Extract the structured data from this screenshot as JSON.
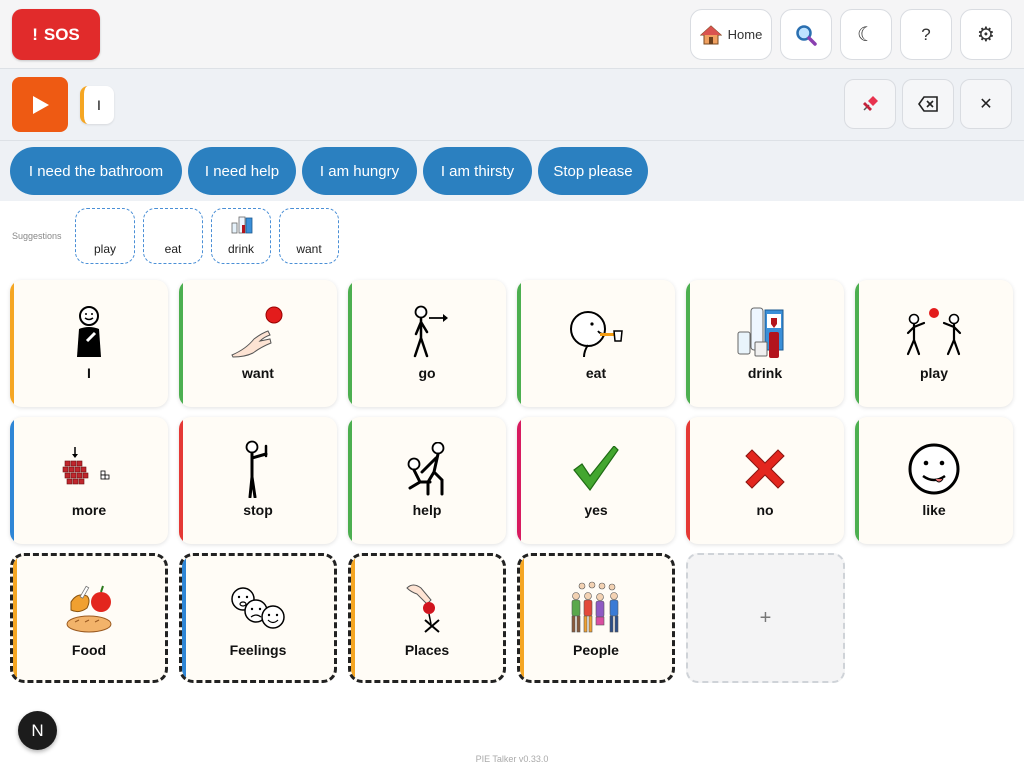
{
  "colors": {
    "sos": "#e12b2b",
    "play": "#ee5a13",
    "phrase": "#2b80c0",
    "orange": "#f5a623",
    "green": "#4caf50",
    "blue": "#2f86d6",
    "red": "#e53935",
    "pink": "#d81b60"
  },
  "header": {
    "sos_icon": "!",
    "sos_label": "SOS",
    "home_label": "Home",
    "moon_glyph": "☾",
    "help_glyph": "?",
    "gear_glyph": "⚙"
  },
  "message": {
    "words": [
      "I"
    ],
    "clear_glyph": "✕"
  },
  "phrases": [
    "I need the bathroom",
    "I need help",
    "I am hungry",
    "I am thirsty",
    "Stop please"
  ],
  "suggestions": {
    "label": "Suggestions",
    "items": [
      "play",
      "eat",
      "drink",
      "want"
    ]
  },
  "tiles": [
    {
      "label": "I",
      "color": "orange"
    },
    {
      "label": "want",
      "color": "green"
    },
    {
      "label": "go",
      "color": "green"
    },
    {
      "label": "eat",
      "color": "green"
    },
    {
      "label": "drink",
      "color": "green"
    },
    {
      "label": "play",
      "color": "green"
    },
    {
      "label": "more",
      "color": "blue"
    },
    {
      "label": "stop",
      "color": "red"
    },
    {
      "label": "help",
      "color": "green"
    },
    {
      "label": "yes",
      "color": "pink"
    },
    {
      "label": "no",
      "color": "red"
    },
    {
      "label": "like",
      "color": "green"
    }
  ],
  "folders": [
    {
      "label": "Food",
      "color": "orange"
    },
    {
      "label": "Feelings",
      "color": "blue"
    },
    {
      "label": "Places",
      "color": "orange"
    },
    {
      "label": "People",
      "color": "orange"
    }
  ],
  "add_tile_glyph": "+",
  "badge": "N",
  "version": "PIE Talker v0.33.0"
}
